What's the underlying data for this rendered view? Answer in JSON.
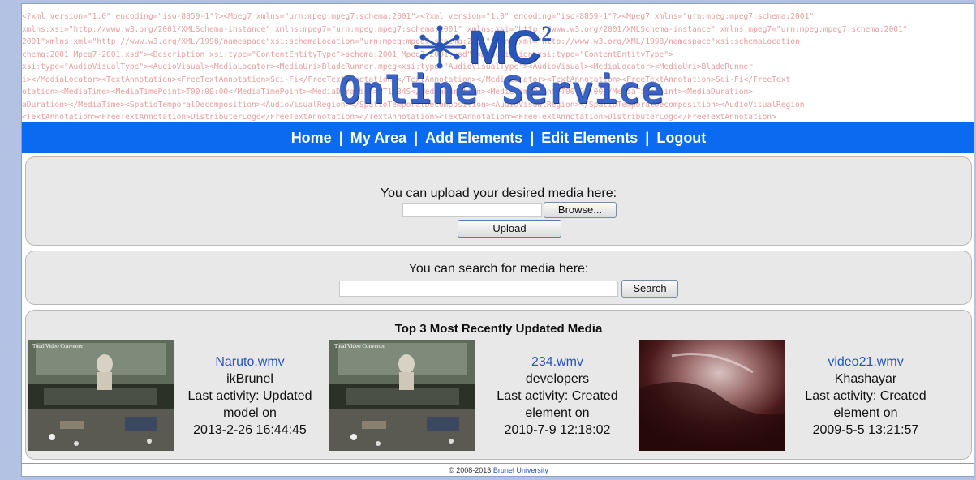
{
  "banner": {
    "xml_lines": [
      "<?xml version=\"1.0\" encoding=\"iso-8859-1\"?><Mpeg7 xmlns=\"urn:mpeg:mpeg7:schema:2001\"><?xml version=\"1.0\" encoding=\"iso-8859-1\"?><Mpeg7 xmlns=\"urn:mpeg:mpeg7:schema:2001\"",
      "xmlns:xsi=\"http://www.w3.org/2001/XMLSchema-instance\" xmlns:mpeg7=\"urn:mpeg:mpeg7:schema:2001\" xmlns:xsi=\"http://www.w3.org/2001/XMLSchema-instance\" xmlns:mpeg7=\"urn:mpeg:mpeg7:schema:2001\"",
      "2001\"xmlns:xml=\"http://www.w3.org/XML/1998/namespace\"xsi:schemaLocation=\"urn:mpeg:mpeg7:schema:2001\"xmlns:xml=\"http://www.w3.org/XML/1998/namespace\"xsi:schemaLocation",
      "chema:2001 Mpeg7-2001.xsd\"><Description xsi:type=\"ContentEntityType\">schema:2001 Mpeg7-2001.xsd\"><Description xsi:type=\"ContentEntityType\">",
      "xsi:type=\"AudioVisualType\"><AudioVisual><MediaLocator><MediaUri>BladeRunner.mpeg<xsi:type=\"AudioVisualType\"><AudioVisual><MediaLocator><MediaUri>BladeRunner",
      "i></MediaLocator><TextAnnotation><FreeTextAnnotation>Sci-Fi</FreeTextAnnotation></TextAnnotation></MediaLocator><TextAnnotation><FreeTextAnnotation>Sci-Fi</FreeText",
      "otation><MediaTime><MediaTimePoint>T00:00:00</MediaTimePoint><MediaDuration>PT1M34S</MediaDuration><MediaTimePoint>T00:00:00</MediaTimePoint><MediaDuration>",
      "aDuration></MediaTime><SpatioTemporalDecomposition><AudioVisualRegion></SpatioTemporalDecomposition><AudioVisualRegion></SpatioTemporalDecomposition><AudioVisualRegion",
      "<TextAnnotation><FreeTextAnnotation>DistributerLogo</FreeTextAnnotation></TextAnnotation><TextAnnotation><FreeTextAnnotation>DistributerLogo</FreeTextAnnotation>"
    ],
    "logo_mc": "MC",
    "logo_sup": "2",
    "logo_service": "Online Service"
  },
  "nav": {
    "home": "Home",
    "sep": "|",
    "my_area": "My Area",
    "add_elements": "Add Elements",
    "edit_elements": "Edit Elements",
    "logout": "Logout"
  },
  "upload": {
    "prompt": "You can upload your desired media here:",
    "browse_label": "Browse...",
    "upload_label": "Upload"
  },
  "search": {
    "prompt": "You can search for media here:",
    "search_label": "Search"
  },
  "recent": {
    "title": "Top 3 Most Recently Updated Media",
    "items": [
      {
        "title": "Naruto.wmv",
        "user": "ikBrunel",
        "activity_1": "Last activity: Updated",
        "activity_2": "model on",
        "date": "2013-2-26 16:44:45",
        "thumb_caption": "Total Video Converter"
      },
      {
        "title": "234.wmv",
        "user": "developers",
        "activity_1": "Last activity: Created",
        "activity_2": "element on",
        "date": "2010-7-9 12:18:02",
        "thumb_caption": "Total Video Converter"
      },
      {
        "title": "video21.wmv",
        "user": "Khashayar",
        "activity_1": "Last activity: Created",
        "activity_2": "element on",
        "date": "2009-5-5 13:21:57"
      }
    ]
  },
  "footer": {
    "copyright": "© 2008-2013 ",
    "link": "Brunel University"
  },
  "colors": {
    "nav_bg": "#0a6af0",
    "link": "#2656b8",
    "page_bg": "#b3c1e3"
  }
}
